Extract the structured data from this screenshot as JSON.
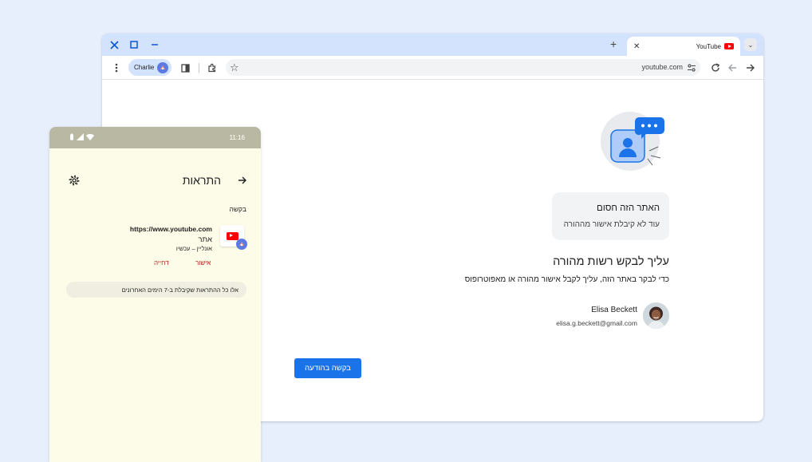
{
  "browser": {
    "tab": {
      "title": "YouTube"
    },
    "new_tab_symbol": "+",
    "profile": {
      "name": "Charlie"
    },
    "omnibox": {
      "url": "youtube.com"
    }
  },
  "block_page": {
    "blocked_title": "האתר הזה חסום",
    "blocked_subtitle": "עוד לא קיבלת אישור מההורה",
    "heading": "עליך לבקש רשות מהורה",
    "subheading": "כדי לבקר באתר הזה, עליך לקבל אישור מהורה או מאפוטרופוס",
    "parent": {
      "name": "Elisa Beckett",
      "email": "elisa.g.beckett@gmail.com"
    },
    "request_button": "בקשה בהודעה"
  },
  "phone": {
    "status_time": "11:16",
    "title": "התראות",
    "section_label": "בקשה",
    "request": {
      "url": "https://www.youtube.com",
      "type": "אתר",
      "status": "אונליין – עכשיו"
    },
    "approve_label": "אישור",
    "deny_label": "דחייה",
    "history_note": "אלו כל ההתראות שקיבלת ב-7 הימים האחרונים"
  },
  "colors": {
    "page_bg": "#e8effc",
    "tabstrip": "#d3e3fd",
    "accent_blue": "#1a73e8",
    "phone_bg": "#fdfce8",
    "action_red": "#b3261e",
    "youtube_red": "#ff0000"
  },
  "icons": {
    "window_close": "close-icon",
    "window_maximize": "maximize-icon",
    "window_minimize": "minimize-icon",
    "menu": "kebab-menu-icon",
    "side_panel": "side-panel-icon",
    "extensions": "puzzle-icon",
    "bookmark": "star-icon",
    "site_info": "tune-icon",
    "reload": "reload-icon",
    "back": "back-arrow-icon",
    "forward": "forward-arrow-icon",
    "settings": "gear-icon"
  }
}
